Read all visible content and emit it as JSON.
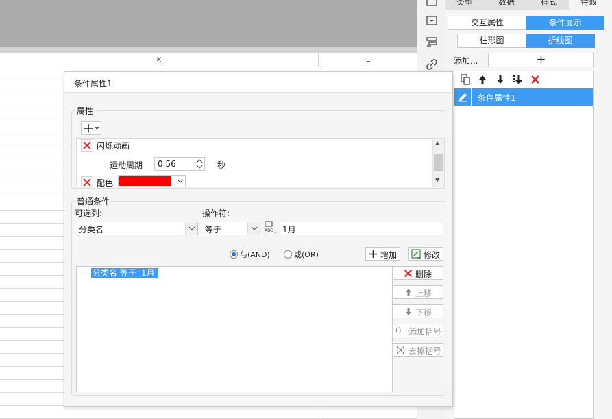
{
  "spreadsheet": {
    "col_k": "K",
    "col_l": "L"
  },
  "right_panel": {
    "top_tabs": [
      "类型",
      "数据",
      "样式",
      "特效"
    ],
    "subtabs": [
      {
        "label": "交互属性",
        "active": false
      },
      {
        "label": "条件显示",
        "active": true
      }
    ],
    "chart_type_tabs": [
      {
        "label": "柱形图",
        "active": false
      },
      {
        "label": "折线图",
        "active": true
      }
    ],
    "add_label": "添加...",
    "add_button": "+",
    "list_items": [
      {
        "label": "条件属性1",
        "selected": true
      }
    ]
  },
  "dialog": {
    "title": "条件属性1",
    "properties_group": {
      "title": "属性",
      "add_button": "+",
      "items": [
        {
          "name": "闪烁动画",
          "sub_label": "运动周期",
          "value": "0.56",
          "unit": "秒"
        },
        {
          "name": "配色",
          "color": "#ff0000"
        }
      ]
    },
    "condition_group": {
      "title": "普通条件",
      "column_label": "可选列:",
      "operator_label": "操作符:",
      "column_value": "分类名",
      "operator_value": "等于",
      "value": "1月",
      "radio_and": "与(AND)",
      "radio_or": "或(OR)",
      "radio_selected": "and",
      "add_button": "增加",
      "modify_button": "修改",
      "delete_button": "删除",
      "move_up_button": "上移",
      "move_down_button": "下移",
      "add_bracket_button": "添加括号",
      "remove_bracket_button": "去掉括号",
      "tree_item": "分类名 等于 '1月'"
    }
  },
  "colors": {
    "accent": "#3d9bf4",
    "delete_red": "#e02020",
    "swatch": "#ff0000"
  }
}
